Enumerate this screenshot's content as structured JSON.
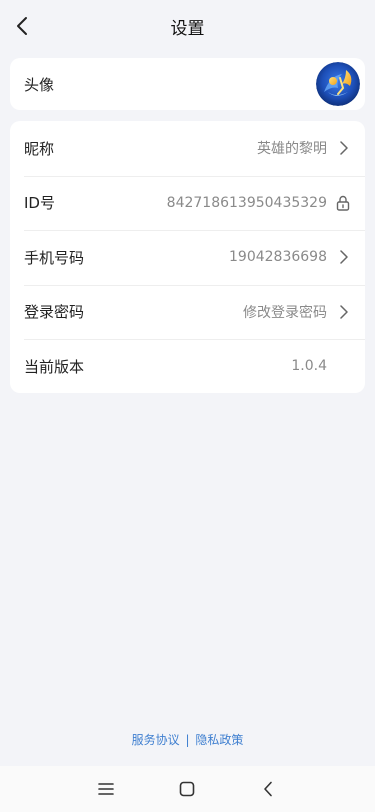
{
  "header": {
    "title": "设置"
  },
  "avatar_row": {
    "label": "头像"
  },
  "rows": [
    {
      "label": "昵称",
      "value": "英雄的黎明",
      "icon": "chevron-right-icon"
    },
    {
      "label": "ID号",
      "value": "842718613950435329",
      "icon": "lock-icon"
    },
    {
      "label": "手机号码",
      "value": "19042836698",
      "icon": "chevron-right-icon"
    },
    {
      "label": "登录密码",
      "value": "修改登录密码",
      "icon": "chevron-right-icon"
    },
    {
      "label": "当前版本",
      "value": "1.0.4",
      "icon": ""
    }
  ],
  "footer": {
    "service_agreement": "服务协议",
    "separator": "|",
    "privacy_policy": "隐私政策"
  },
  "colors": {
    "background": "#f3f4f8",
    "card": "#ffffff",
    "link": "#3f7fd0",
    "value_text": "#8a8a8a"
  },
  "system_nav": {
    "icons": [
      "menu-icon",
      "home-square-icon",
      "back-icon"
    ]
  }
}
